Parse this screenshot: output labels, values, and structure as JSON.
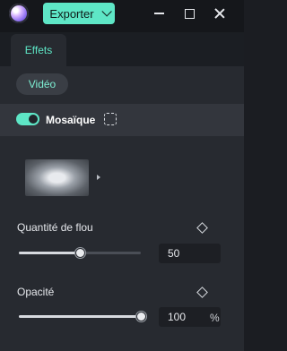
{
  "titlebar": {
    "export_label": "Exporter"
  },
  "tabs": {
    "effects_label": "Effets",
    "video_label": "Vidéo"
  },
  "effect": {
    "enabled": true,
    "name": "Mosaïque"
  },
  "params": {
    "blur": {
      "label": "Quantité de flou",
      "value": "50",
      "level_fraction": 0.5
    },
    "opacity": {
      "label": "Opacité",
      "value": "100",
      "unit": "%",
      "level_fraction": 1.0
    }
  },
  "colors": {
    "accent": "#5ee6c6",
    "panel_bg": "#272a30",
    "titlebar_bg": "#15171b"
  },
  "icons": {
    "app_logo": "app-logo-icon",
    "export_dropdown": "chevron-down-icon",
    "minimize": "minimize-icon",
    "maximize": "maximize-icon",
    "close": "close-icon",
    "effect_settings": "mosaic-dashed-square-icon",
    "keyframe": "keyframe-diamond-icon",
    "preview_expand": "caret-right-icon"
  }
}
